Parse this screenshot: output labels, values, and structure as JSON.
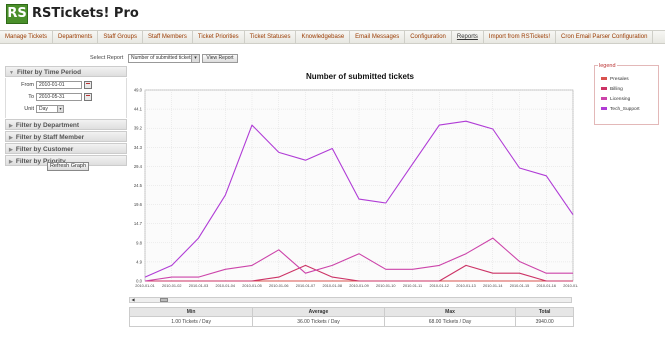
{
  "app": {
    "logo_text": "RS",
    "title": "RSTickets! Pro"
  },
  "nav": [
    "Manage Tickets",
    "Departments",
    "Staff Groups",
    "Staff Members",
    "Ticket Priorities",
    "Ticket Statuses",
    "Knowledgebase",
    "Email Messages",
    "Configuration",
    "Reports",
    "Import from RSTickets!",
    "Cron Email Parser Configuration"
  ],
  "nav_active_index": 9,
  "report": {
    "label": "Select Report",
    "selected": "Number of submitted tickets",
    "view_button": "View Report"
  },
  "filters": {
    "time_period": {
      "title": "Filter by Time Period",
      "from_label": "From",
      "from_value": "2010-01-01",
      "to_label": "To",
      "to_value": "2010-05-31",
      "unit_label": "Unit",
      "unit_value": "Day"
    },
    "department": "Filter by Department",
    "staff_member": "Filter by Staff Member",
    "customer": "Filter by Customer",
    "priority": "Filter by Priority",
    "refresh_button": "Refresh Graph"
  },
  "legend": {
    "title": "legend"
  },
  "stats": {
    "headers": [
      "Min",
      "Average",
      "Max",
      "Total"
    ],
    "values": [
      "1.00 Tickets / Day",
      "36.00 Tickets / Day",
      "68.00 Tickets / Day",
      "3940.00"
    ]
  },
  "colors": {
    "nav_text": "#9a3a00",
    "logo_bg": "#4a8f2a",
    "presales": "#d9534f",
    "billing": "#cc3366",
    "licensing": "#cc44aa",
    "tech_support": "#b03cd6"
  },
  "chart_data": {
    "type": "line",
    "title": "Number of submitted tickets",
    "x": [
      "2010-01-01",
      "2010-01-02",
      "2010-01-03",
      "2010-01-04",
      "2010-01-05",
      "2010-01-06",
      "2010-01-07",
      "2010-01-08",
      "2010-01-09",
      "2010-01-10",
      "2010-01-11",
      "2010-01-12",
      "2010-01-13",
      "2010-01-14",
      "2010-01-15",
      "2010-01-16",
      "2010-01-17"
    ],
    "ylim": [
      0,
      49
    ],
    "yticks": [
      "0.0",
      "4.9",
      "9.8",
      "14.7",
      "19.6",
      "24.5",
      "29.4",
      "34.3",
      "39.2",
      "44.1",
      "49.0"
    ],
    "grid": true,
    "legend_position": "right",
    "series": [
      {
        "name": "Presales",
        "color": "#d9534f",
        "values": [
          0,
          0,
          0,
          0,
          0,
          0,
          0,
          0,
          0,
          0,
          0,
          0,
          0,
          0,
          0,
          0,
          0
        ]
      },
      {
        "name": "Billing",
        "color": "#cc3366",
        "values": [
          0,
          0,
          0,
          0,
          0,
          1,
          4,
          1,
          0,
          0,
          0,
          0,
          4,
          2,
          2,
          0,
          0
        ]
      },
      {
        "name": "Licensing",
        "color": "#cc44aa",
        "values": [
          0,
          1,
          1,
          3,
          4,
          8,
          2,
          4,
          7,
          3,
          3,
          4,
          7,
          11,
          5,
          2,
          2
        ]
      },
      {
        "name": "Tech_Support",
        "color": "#b03cd6",
        "values": [
          1,
          4,
          11,
          22,
          40,
          33,
          31,
          34,
          21,
          20,
          30,
          40,
          41,
          39,
          29,
          27,
          17
        ]
      }
    ]
  }
}
